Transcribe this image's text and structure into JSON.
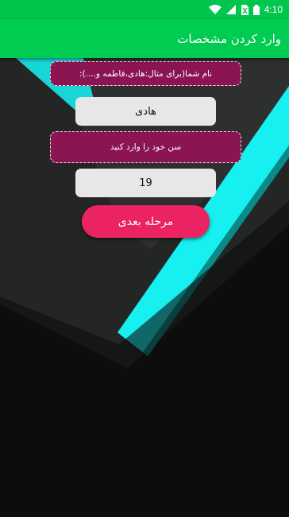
{
  "status_bar": {
    "time": "4:10"
  },
  "app_bar": {
    "title": "وارد کردن مشخصات"
  },
  "form": {
    "name_label": "نام شما(برای مثال:هادی،فاطمه و....):",
    "name_value": "هادی",
    "age_label": "سن خود را وارد کنید",
    "age_value": "19",
    "next_button": "مرحله بعدی"
  },
  "colors": {
    "app_bar": "#00cc51",
    "label_box": "#8b1452",
    "button": "#ec2362",
    "accent_stripe": "#18f2f2"
  }
}
